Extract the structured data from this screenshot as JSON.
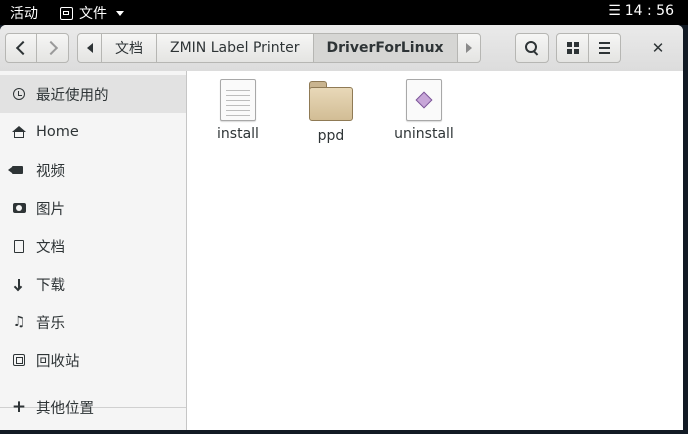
{
  "topbar": {
    "activities": "活动",
    "app_menu": "文件",
    "time": "14 : 56"
  },
  "pathbar": {
    "crumbs": [
      "文档",
      "ZMIN Label Printer",
      "DriverForLinux"
    ]
  },
  "sidebar": {
    "items": [
      {
        "label": "最近使用的",
        "icon": "clock-icon"
      },
      {
        "label": "Home",
        "icon": "home-icon"
      },
      {
        "label": "视频",
        "icon": "video-icon"
      },
      {
        "label": "图片",
        "icon": "camera-icon"
      },
      {
        "label": "文档",
        "icon": "document-icon"
      },
      {
        "label": "下载",
        "icon": "download-icon"
      },
      {
        "label": "音乐",
        "icon": "music-icon"
      },
      {
        "label": "回收站",
        "icon": "trash-icon"
      },
      {
        "label": "其他位置",
        "icon": "plus-icon"
      }
    ]
  },
  "files": [
    {
      "name": "install",
      "type": "text-file-icon"
    },
    {
      "name": "ppd",
      "type": "folder-icon"
    },
    {
      "name": "uninstall",
      "type": "script-icon"
    }
  ],
  "colors": {
    "topbar": "#000000",
    "headerbar": "#e0e0e0",
    "sidebar": "#f5f5f5",
    "selected": "#e2e2e2"
  }
}
